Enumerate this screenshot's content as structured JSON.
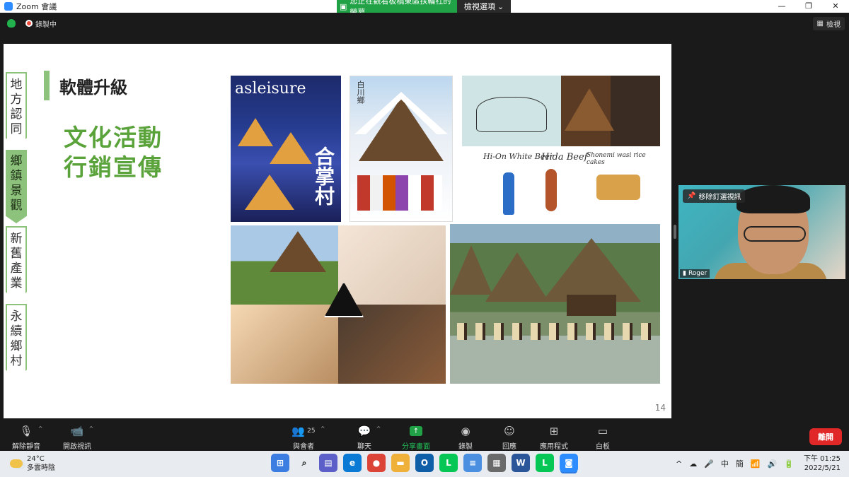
{
  "window": {
    "app_title": "Zoom 會議",
    "share_banner": "您正在觀看板橋東區扶輪社的螢幕",
    "view_options": "檢視選項",
    "controls": {
      "minimize": "—",
      "restore": "❐",
      "close": "✕"
    }
  },
  "topbar": {
    "recording_label": "錄製中",
    "view_label": "檢視"
  },
  "slide": {
    "title": "軟體升級",
    "headline_line1": "文化活動",
    "headline_line2": "行銷宣傳",
    "page_number": "14",
    "nav_sections": [
      {
        "label": "地方認同",
        "chars": [
          "地",
          "方",
          "認",
          "同"
        ],
        "state": "outline"
      },
      {
        "label": "鄉鎮景觀",
        "chars": [
          "鄉",
          "鎮",
          "景",
          "觀"
        ],
        "state": "active"
      },
      {
        "label": "新舊產業",
        "chars": [
          "新",
          "舊",
          "產",
          "業"
        ],
        "state": "outline"
      },
      {
        "label": "永續鄉村",
        "chars": [
          "永",
          "續",
          "鄉",
          "村"
        ],
        "state": "outline"
      }
    ],
    "image_texts": {
      "magazine_logo": "asleisure",
      "magazine_title": "合掌村",
      "poster_title": "白川鄉",
      "illustration_1": "Hi-On White Beer",
      "illustration_2": "Hida Beef",
      "illustration_3": "Shonemi wasi rice cakes"
    }
  },
  "video": {
    "unpin_label": "移除釘選視訊",
    "participant_name": "Roger"
  },
  "toolbar": {
    "unmute": "解除靜音",
    "start_video": "開啟視訊",
    "participants": "與會者",
    "participant_count": "25",
    "chat": "聊天",
    "share_screen": "分享畫面",
    "record": "錄製",
    "reactions": "回應",
    "apps": "應用程式",
    "whiteboard": "白板",
    "leave": "離開"
  },
  "taskbar": {
    "weather_temp": "24°C",
    "weather_desc": "多雲時陰",
    "clock_time": "下午 01:25",
    "clock_date": "2022/5/21",
    "ime_1": "中",
    "ime_2": "簡"
  },
  "colors": {
    "accent_green": "#8cc27b",
    "headline_green": "#5aa23a",
    "share_green": "#22a246",
    "leave_red": "#e02828",
    "zoom_blue": "#2d8cff"
  }
}
